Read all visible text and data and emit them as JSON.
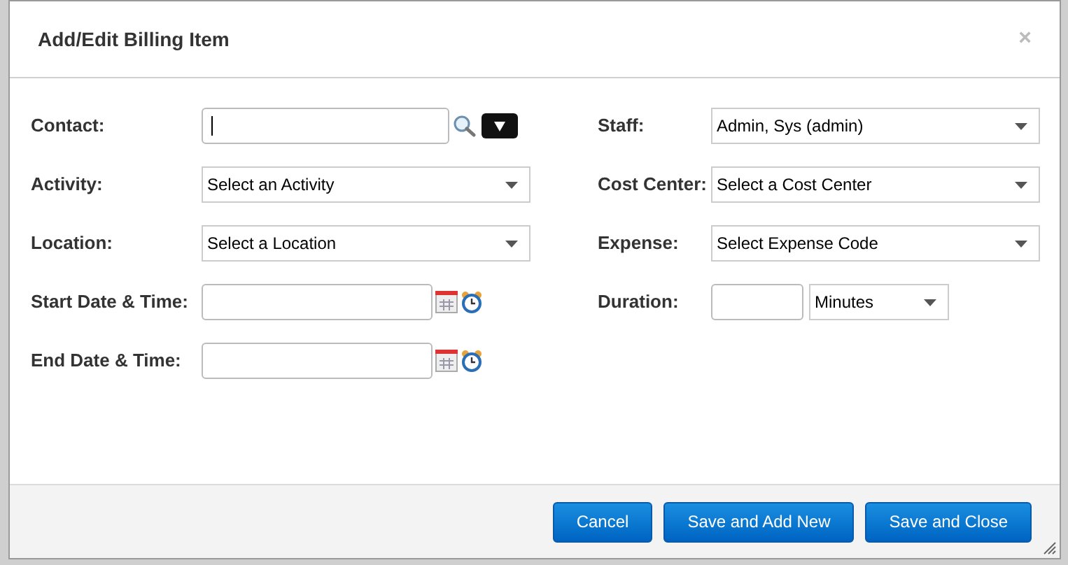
{
  "dialog": {
    "title": "Add/Edit Billing Item",
    "close": "×"
  },
  "left_fields": [
    {
      "kind": "lookup",
      "label": "Contact:"
    },
    {
      "kind": "select",
      "label": "Activity:",
      "value": "Select an Activity"
    },
    {
      "kind": "select",
      "label": "Location:",
      "value": "Select a Location"
    },
    {
      "kind": "datetime",
      "label": "Start Date & Time:"
    },
    {
      "kind": "datetime",
      "label": "End Date & Time:"
    }
  ],
  "right_fields": [
    {
      "kind": "select",
      "label": "Staff:",
      "value": "Admin, Sys (admin)"
    },
    {
      "kind": "select",
      "label": "Cost Center:",
      "value": "Select a Cost Center"
    },
    {
      "kind": "select",
      "label": "Expense:",
      "value": "Select Expense Code"
    },
    {
      "kind": "duration",
      "label": "Duration:",
      "unit": "Minutes"
    }
  ],
  "buttons": [
    "Cancel",
    "Save and Add New",
    "Save and Close"
  ]
}
